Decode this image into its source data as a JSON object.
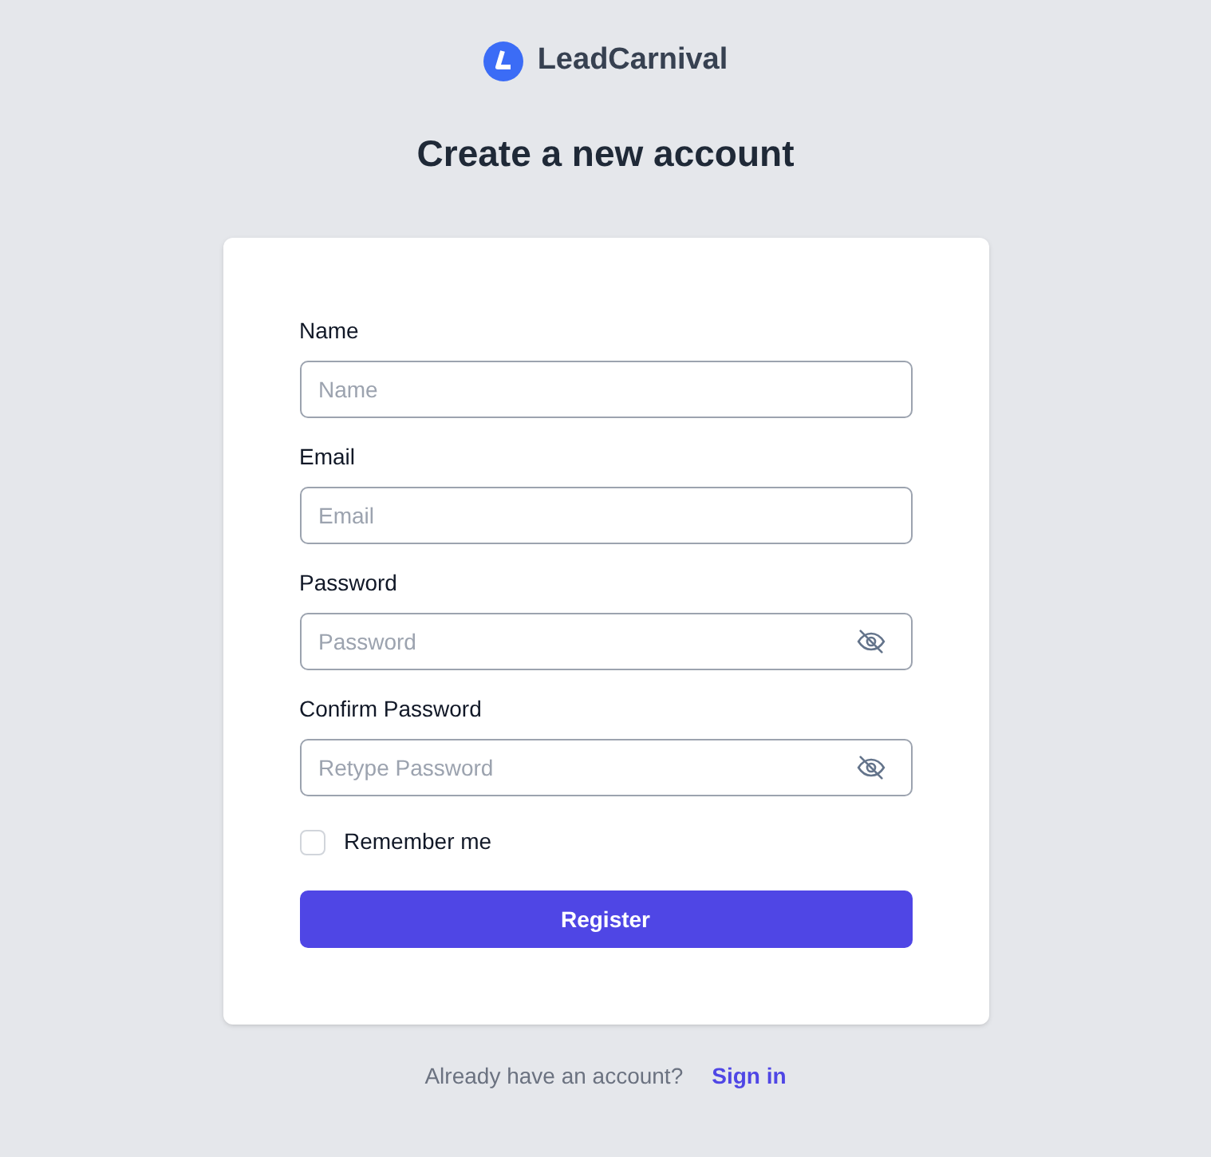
{
  "brand": {
    "name": "LeadCarnival"
  },
  "heading": "Create a new account",
  "form": {
    "fields": [
      {
        "label": "Name",
        "placeholder": "Name",
        "kind": "text"
      },
      {
        "label": "Email",
        "placeholder": "Email",
        "kind": "text"
      },
      {
        "label": "Password",
        "placeholder": "Password",
        "kind": "password"
      },
      {
        "label": "Confirm Password",
        "placeholder": "Retype Password",
        "kind": "password"
      }
    ],
    "remember": {
      "label": "Remember me",
      "checked": false
    },
    "submit": "Register"
  },
  "footer": {
    "text": "Already have an account?",
    "link": "Sign in"
  }
}
